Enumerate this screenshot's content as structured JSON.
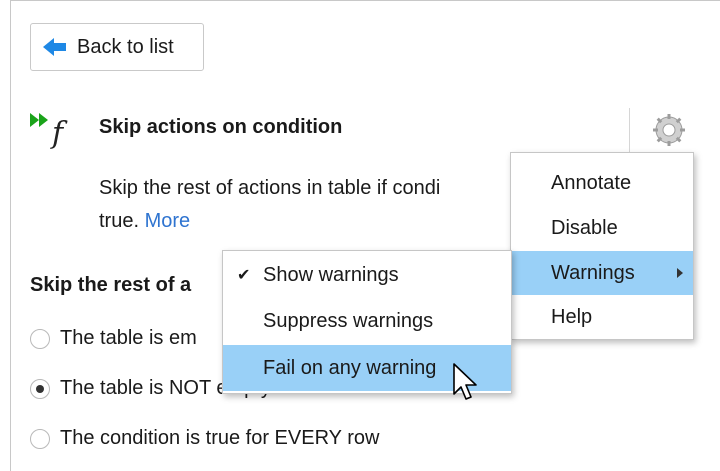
{
  "back_button": {
    "label": "Back to list"
  },
  "action": {
    "title": "Skip actions on condition",
    "description_line1": "Skip the rest of actions in table if condi",
    "description_line2": "true.",
    "more_link": "More"
  },
  "section": {
    "title": "Skip the rest of a"
  },
  "radios": [
    {
      "label": "The table is em",
      "checked": false
    },
    {
      "label": "The table is NOT empty",
      "checked": true
    },
    {
      "label": "The condition is true for EVERY row",
      "checked": false
    }
  ],
  "context_menu": {
    "items": [
      {
        "label": "Annotate"
      },
      {
        "label": "Disable"
      },
      {
        "label": "Warnings",
        "highlighted": true,
        "has_submenu": true
      },
      {
        "label": "Help"
      }
    ]
  },
  "warnings_submenu": {
    "items": [
      {
        "label": "Show warnings",
        "checked": true
      },
      {
        "label": "Suppress warnings",
        "checked": false
      },
      {
        "label": "Fail on any warning",
        "highlighted": true
      }
    ]
  },
  "colors": {
    "accent_blue": "#1e88e5",
    "link": "#2f74d0",
    "highlight": "#99d0f7",
    "run_green": "#1aa31a"
  },
  "icons": [
    "arrow-left-icon",
    "double-play-icon",
    "function-icon",
    "gear-icon",
    "check-icon",
    "submenu-arrow-icon",
    "mouse-pointer-icon"
  ]
}
